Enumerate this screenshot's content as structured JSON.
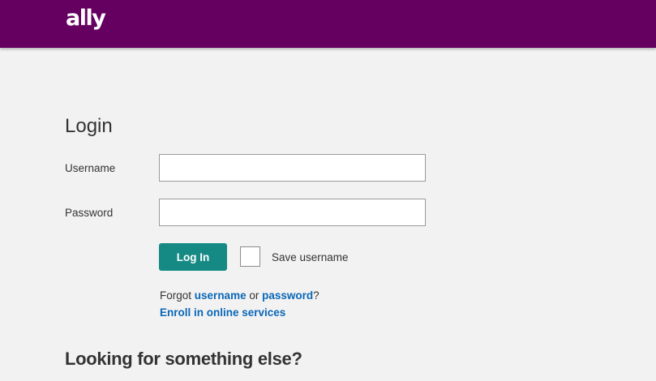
{
  "header": {
    "logo_text": "ally",
    "background_color": "#650060"
  },
  "login": {
    "title": "Login",
    "username_label": "Username",
    "username_value": "",
    "password_label": "Password",
    "password_value": "",
    "login_button_label": "Log In",
    "login_button_color": "#158a85",
    "save_username_label": "Save username",
    "save_username_checked": false,
    "forgot_prefix": "Forgot",
    "forgot_username_link": "username",
    "forgot_or": "or",
    "forgot_password_link": "password",
    "forgot_suffix": "?",
    "enroll_link": "Enroll in online services",
    "link_color": "#0a67b7"
  },
  "other": {
    "heading": "Looking for something else?"
  }
}
